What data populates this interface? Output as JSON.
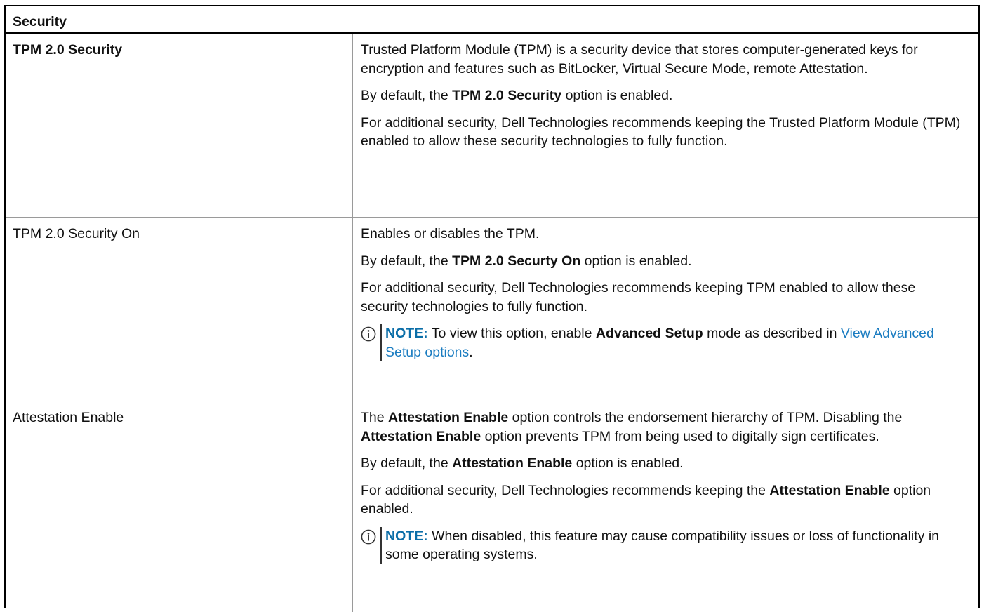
{
  "table": {
    "header": "Security",
    "rows": [
      {
        "option": "TPM 2.0 Security",
        "paragraphs": [
          {
            "text": "Trusted Platform Module (TPM) is a security device that stores computer-generated keys for encryption and features such as BitLocker, Virtual Secure Mode, remote Attestation."
          },
          {
            "pre": "By default, the ",
            "bold": "TPM 2.0 Security",
            "post": " option is enabled."
          },
          {
            "text": "For additional security, Dell Technologies recommends keeping the Trusted Platform Module (TPM) enabled to allow these security technologies to fully function."
          }
        ]
      },
      {
        "option": "TPM 2.0 Security On",
        "paragraphs": [
          {
            "text": "Enables or disables the TPM."
          },
          {
            "pre": "By default, the ",
            "bold": "TPM 2.0 Securty On",
            "post": " option is enabled."
          },
          {
            "text": "For additional security, Dell Technologies recommends keeping TPM enabled to allow these security technologies to fully function."
          }
        ],
        "note": {
          "label": "NOTE:",
          "pre": " To view this option, enable ",
          "bold": "Advanced Setup",
          "mid": " mode as described in ",
          "link": "View Advanced Setup options",
          "post": "."
        }
      },
      {
        "option": "Attestation Enable",
        "paragraphs": [
          {
            "pre": "The ",
            "bold": "Attestation Enable",
            "post": " option controls the endorsement hierarchy of TPM. Disabling the ",
            "bold2": "Attestation Enable",
            "post2": " option prevents TPM from being used to digitally sign certificates."
          },
          {
            "pre": "By default, the ",
            "bold": "Attestation Enable",
            "post": " option is enabled."
          },
          {
            "pre": "For additional security, Dell Technologies recommends keeping the ",
            "bold": "Attestation Enable",
            "post": " option enabled."
          }
        ],
        "note": {
          "label": "NOTE:",
          "text": " When disabled, this feature may cause compatibility issues or loss of functionality in some operating systems."
        }
      }
    ]
  },
  "colors": {
    "note_label": "#0b6ea8",
    "link": "#1a7cc1"
  },
  "icons": {
    "note": "info-circle-icon"
  }
}
